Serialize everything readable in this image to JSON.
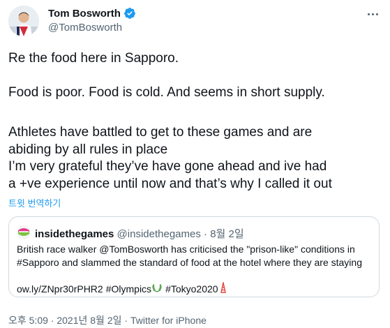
{
  "author": {
    "display_name": "Tom Bosworth",
    "handle": "@TomBosworth",
    "verified_icon": "verified-badge-icon"
  },
  "tweet": {
    "lines": [
      "Re the food here in Sapporo.",
      "Food is poor. Food is cold. And seems in short supply.",
      "Athletes have battled to get to these games and are",
      "abiding by all rules in place",
      "I’m very grateful they’ve have gone ahead and ive had",
      "a +ve experience until now and that’s why I called it out"
    ],
    "translate_label": "트윗 번역하기"
  },
  "quote": {
    "name": "insidethegames",
    "handle": "@insidethegames",
    "separator": " · ",
    "date": "8월 2일",
    "text_lines": [
      "British race walker @TomBosworth has criticised the \"prison-like\" conditions in",
      "#Sapporo and slammed the standard of food at the hotel where they are staying"
    ],
    "link": "ow.ly/ZNpr30rPHR2",
    "hashtag_olympics": "#Olympics",
    "hashtag_tokyo": "#Tokyo2020"
  },
  "meta": {
    "time": "오후 5:09",
    "separator": " · ",
    "date": "2021년 8월 2일",
    "source": "Twitter for iPhone"
  },
  "colors": {
    "accent": "#1d9bf0",
    "text": "#0f1419",
    "muted": "#536471",
    "border": "#cfd9de"
  }
}
